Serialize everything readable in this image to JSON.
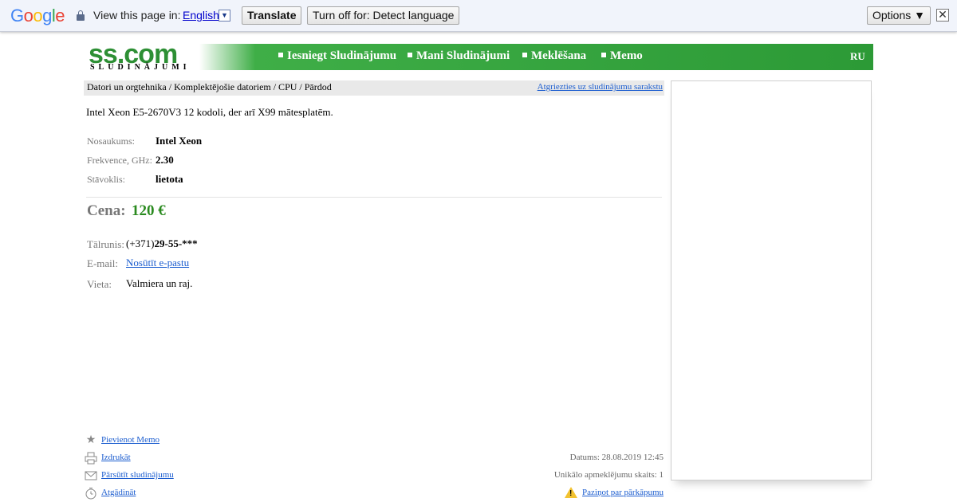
{
  "translate_bar": {
    "logo": "Google",
    "view_text": "View this page in:",
    "language": "English",
    "translate_button": "Translate",
    "turn_off_button": "Turn off for: Detect language",
    "options_button": "Options ▼",
    "close_icon": "close-icon"
  },
  "header": {
    "logo_main": "ss.com",
    "logo_sub": "SLUDINĀJUMI",
    "nav": [
      "Iesniegt Sludinājumu",
      "Mani Sludinājumi",
      "Meklēšana",
      "Memo"
    ],
    "lang": "RU",
    "brand_color": "#2c9a36"
  },
  "breadcrumb": {
    "path": "Datori un orgtehnika / Komplektējošie datoriem / CPU / Pārdod",
    "back_link": "Atgriezties uz sludinājumu sarakstu"
  },
  "ad": {
    "title": "Intel Xeon E5-2670V3 12 kodoli, der arī X99 mātesplatēm.",
    "specs": [
      {
        "label": "Nosaukums:",
        "value": "Intel Xeon"
      },
      {
        "label": "Frekvence, GHz:",
        "value": "2.30"
      },
      {
        "label": "Stāvoklis:",
        "value": "lietota"
      }
    ],
    "price_label": "Cena:",
    "price_value": "120 €",
    "price_color": "#2a8a1f",
    "contacts": {
      "phone_label": "Tālrunis:",
      "phone_prefix": "(+371)",
      "phone_number": "29-55-***",
      "email_label": "E-mail:",
      "email_link": "Nosūtīt e-pastu",
      "place_label": "Vieta:",
      "place_value": "Valmiera un raj."
    }
  },
  "actions": [
    {
      "icon": "star-icon",
      "label": "Pievienot Memo"
    },
    {
      "icon": "printer-icon",
      "label": "Izdrukāt"
    },
    {
      "icon": "envelope-icon",
      "label": "Pārsūtīt sludinājumu"
    },
    {
      "icon": "clock-icon",
      "label": "Atgādināt"
    }
  ],
  "meta": {
    "date": "Datums: 28.08.2019 12:45",
    "views": "Unikālo apmeklējumu skaits: 1",
    "report_icon": "warning-icon",
    "report": "Paziņot par pārkāpumu"
  }
}
